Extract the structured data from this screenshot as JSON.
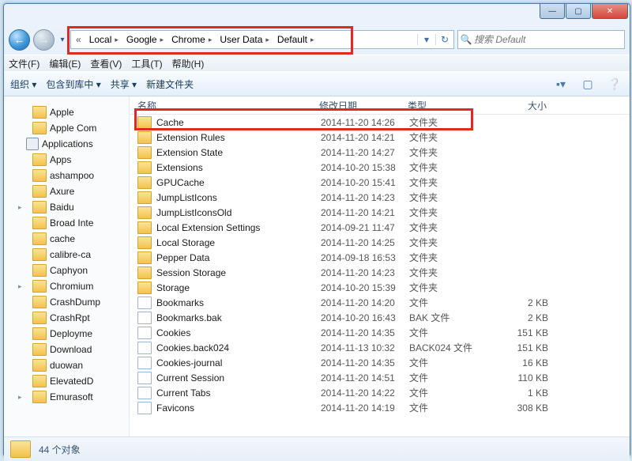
{
  "win_buttons": {
    "min": "—",
    "max": "▢",
    "close": "✕"
  },
  "nav": {
    "back": "←",
    "fwd": "→",
    "drop": "▾",
    "refresh": "↻"
  },
  "breadcrumb": {
    "lead": "«",
    "items": [
      "Local",
      "Google",
      "Chrome",
      "User Data",
      "Default"
    ]
  },
  "search": {
    "placeholder": "搜索 Default"
  },
  "menubar": [
    "文件(F)",
    "编辑(E)",
    "查看(V)",
    "工具(T)",
    "帮助(H)"
  ],
  "toolbar": {
    "org": "组织 ▾",
    "inc": "包含到库中 ▾",
    "share": "共享 ▾",
    "newf": "新建文件夹"
  },
  "columns": {
    "name": "名称",
    "date": "修改日期",
    "type": "类型",
    "size": "大小"
  },
  "tree": [
    {
      "label": "Apple"
    },
    {
      "label": "Apple Com"
    },
    {
      "label": "Applications",
      "shift": true
    },
    {
      "label": "Apps"
    },
    {
      "label": "ashampoo"
    },
    {
      "label": "Axure"
    },
    {
      "label": "Baidu",
      "tw": "▸"
    },
    {
      "label": "Broad Inte"
    },
    {
      "label": "cache"
    },
    {
      "label": "calibre-ca"
    },
    {
      "label": "Caphyon"
    },
    {
      "label": "Chromium",
      "tw": "▸"
    },
    {
      "label": "CrashDump"
    },
    {
      "label": "CrashRpt"
    },
    {
      "label": "Deployme"
    },
    {
      "label": "Download"
    },
    {
      "label": "duowan"
    },
    {
      "label": "ElevatedD"
    },
    {
      "label": "Emurasoft",
      "tw": "▸"
    }
  ],
  "files": [
    {
      "name": "Cache",
      "date": "2014-11-20 14:26",
      "type": "文件夹",
      "size": "",
      "folder": true
    },
    {
      "name": "Extension Rules",
      "date": "2014-11-20 14:21",
      "type": "文件夹",
      "size": "",
      "folder": true
    },
    {
      "name": "Extension State",
      "date": "2014-11-20 14:27",
      "type": "文件夹",
      "size": "",
      "folder": true
    },
    {
      "name": "Extensions",
      "date": "2014-10-20 15:38",
      "type": "文件夹",
      "size": "",
      "folder": true
    },
    {
      "name": "GPUCache",
      "date": "2014-10-20 15:41",
      "type": "文件夹",
      "size": "",
      "folder": true
    },
    {
      "name": "JumpListIcons",
      "date": "2014-11-20 14:23",
      "type": "文件夹",
      "size": "",
      "folder": true
    },
    {
      "name": "JumpListIconsOld",
      "date": "2014-11-20 14:21",
      "type": "文件夹",
      "size": "",
      "folder": true
    },
    {
      "name": "Local Extension Settings",
      "date": "2014-09-21 11:47",
      "type": "文件夹",
      "size": "",
      "folder": true
    },
    {
      "name": "Local Storage",
      "date": "2014-11-20 14:25",
      "type": "文件夹",
      "size": "",
      "folder": true
    },
    {
      "name": "Pepper Data",
      "date": "2014-09-18 16:53",
      "type": "文件夹",
      "size": "",
      "folder": true
    },
    {
      "name": "Session Storage",
      "date": "2014-11-20 14:23",
      "type": "文件夹",
      "size": "",
      "folder": true
    },
    {
      "name": "Storage",
      "date": "2014-10-20 15:39",
      "type": "文件夹",
      "size": "",
      "folder": true
    },
    {
      "name": "Bookmarks",
      "date": "2014-11-20 14:20",
      "type": "文件",
      "size": "2 KB",
      "folder": false
    },
    {
      "name": "Bookmarks.bak",
      "date": "2014-10-20 16:43",
      "type": "BAK 文件",
      "size": "2 KB",
      "folder": false
    },
    {
      "name": "Cookies",
      "date": "2014-11-20 14:35",
      "type": "文件",
      "size": "151 KB",
      "folder": false
    },
    {
      "name": "Cookies.back024",
      "date": "2014-11-13 10:32",
      "type": "BACK024 文件",
      "size": "151 KB",
      "folder": false
    },
    {
      "name": "Cookies-journal",
      "date": "2014-11-20 14:35",
      "type": "文件",
      "size": "16 KB",
      "folder": false
    },
    {
      "name": "Current Session",
      "date": "2014-11-20 14:51",
      "type": "文件",
      "size": "110 KB",
      "folder": false
    },
    {
      "name": "Current Tabs",
      "date": "2014-11-20 14:22",
      "type": "文件",
      "size": "1 KB",
      "folder": false
    },
    {
      "name": "Favicons",
      "date": "2014-11-20 14:19",
      "type": "文件",
      "size": "308 KB",
      "folder": false
    }
  ],
  "status": "44 个对象"
}
